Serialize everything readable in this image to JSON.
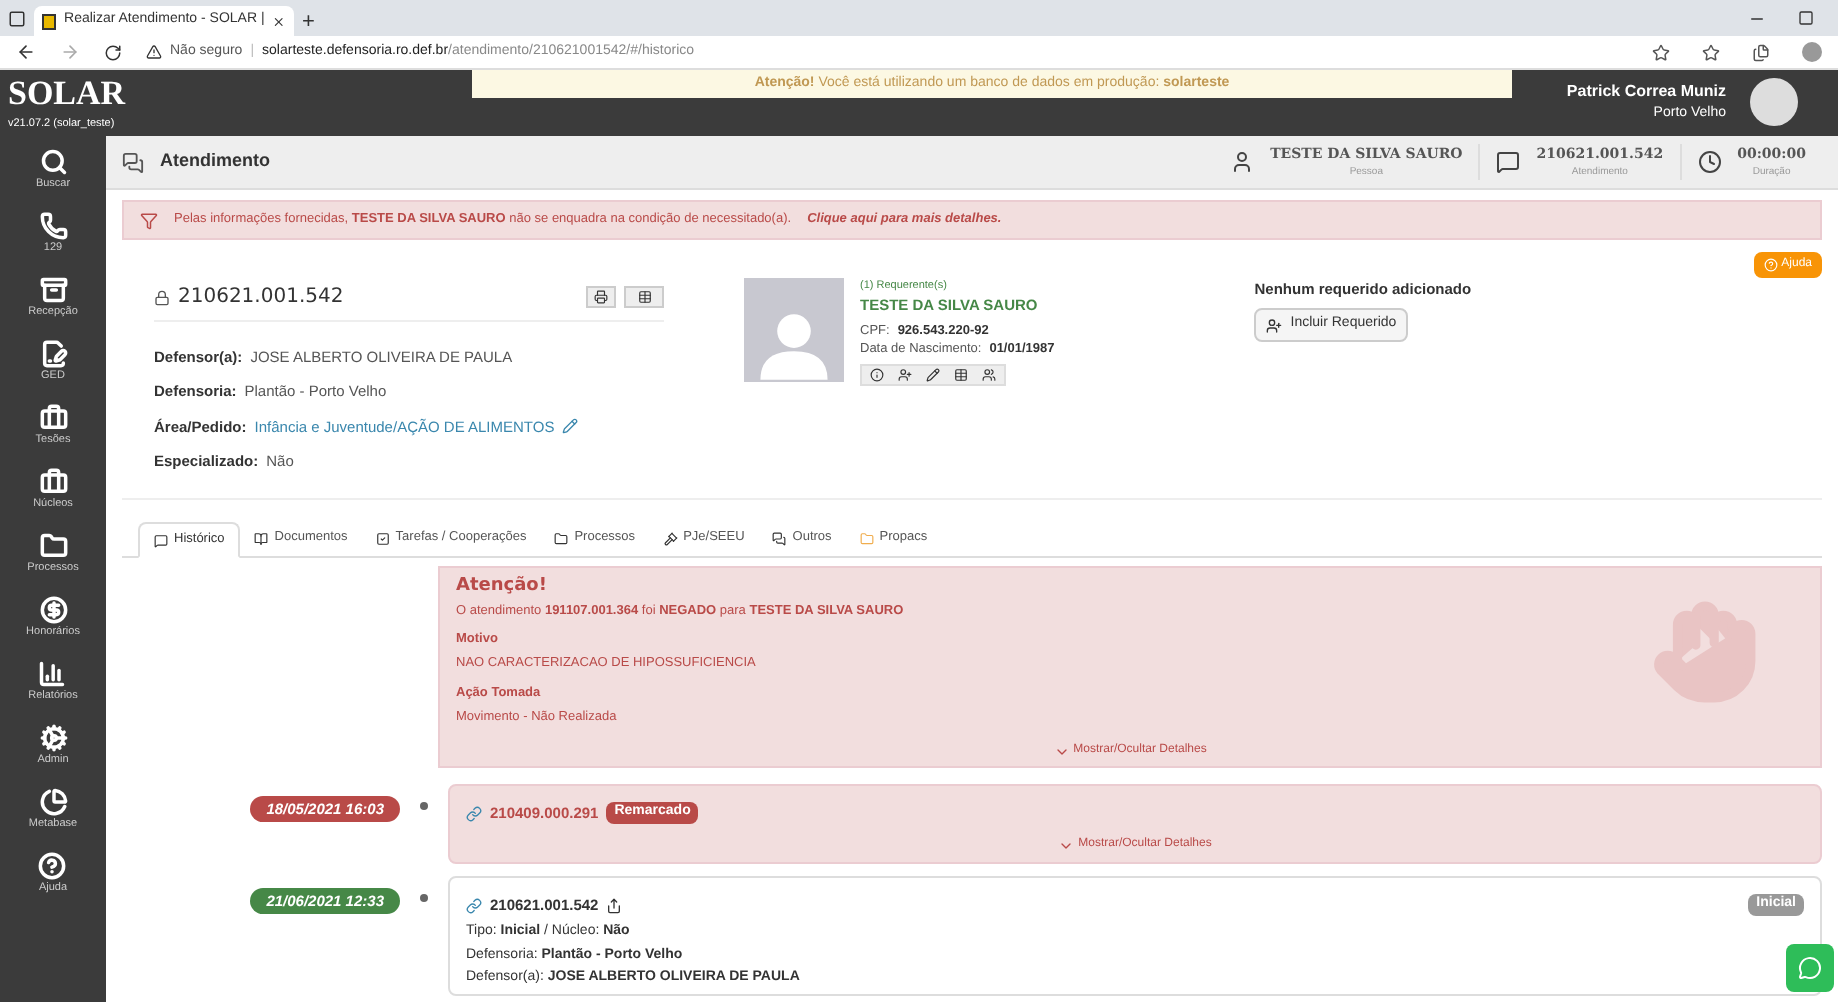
{
  "browser": {
    "tab_title": "Realizar Atendimento - SOLAR |",
    "new_tab": "+",
    "security": "Não seguro",
    "separator": "|",
    "url_host": "solarteste.defensoria.ro.def.br",
    "url_path": "/atendimento/210621001542/#/historico"
  },
  "topbar": {
    "logo": "SOLAR",
    "version": "v21.07.2 (solar_teste)",
    "banner": "**Atenção!** Você está utilizando um banco de dados em produção: **solarteste**",
    "user_name": "Patrick Correa Muniz",
    "user_place": "Porto Velho"
  },
  "sidebar": [
    {
      "label": "Buscar"
    },
    {
      "label": "129"
    },
    {
      "label": "Recepção"
    },
    {
      "label": "GED"
    },
    {
      "label": "Tesões"
    },
    {
      "label": "Núcleos"
    },
    {
      "label": "Processos"
    },
    {
      "label": "Honorários"
    },
    {
      "label": "Relatórios"
    },
    {
      "label": "Admin"
    },
    {
      "label": "Metabase"
    },
    {
      "label": "Ajuda"
    }
  ],
  "header": {
    "title": "Atendimento",
    "stats": [
      {
        "value": "TESTE DA SILVA SAURO",
        "label": "Pessoa"
      },
      {
        "value": "210621.001.542",
        "label": "Atendimento"
      },
      {
        "value": "00:00:00",
        "label": "Duração"
      }
    ]
  },
  "alert": {
    "text": "Pelas informações fornecidas, **TESTE DA SILVA SAURO** não se enquadra na condição de necessitado(a).",
    "link": "Clique aqui para mais detalhes."
  },
  "help_button": "Ajuda",
  "case": {
    "number": "210621.001.542",
    "fields": [
      {
        "label": "Defensor(a):",
        "value": "JOSE ALBERTO OLIVEIRA DE PAULA",
        "kind": "plain"
      },
      {
        "label": "Defensoria:",
        "value": "Plantão - Porto Velho",
        "kind": "plain"
      },
      {
        "label": "Área/Pedido:",
        "value": "Infância e Juventude/AÇÃO DE ALIMENTOS",
        "kind": "link"
      },
      {
        "label": "Especializado:",
        "value": "Não",
        "kind": "plain"
      }
    ]
  },
  "requerente": {
    "count": "(1) Requerente(s)",
    "name": "TESTE DA SILVA SAURO",
    "cpf_label": "CPF:",
    "cpf": "926.543.220-92",
    "birth_label": "Data de Nascimento:",
    "birth": "01/01/1987"
  },
  "requerido": {
    "empty": "Nenhum requerido adicionado",
    "button": "Incluir Requerido"
  },
  "tabs": [
    {
      "label": "Histórico",
      "selected": true
    },
    {
      "label": "Documentos",
      "selected": false
    },
    {
      "label": "Tarefas / Cooperações",
      "selected": false
    },
    {
      "label": "Processos",
      "selected": false
    },
    {
      "label": "PJe/SEEU",
      "selected": false
    },
    {
      "label": "Outros",
      "selected": false
    },
    {
      "label": "Propacs",
      "selected": false
    }
  ],
  "notice": {
    "title": "Atenção!",
    "text": "O atendimento **191107.001.364** foi **NEGADO** para **TESTE DA SILVA SAURO**",
    "sections": [
      {
        "label": "Motivo",
        "value": "NAO CARACTERIZACAO DE HIPOSSUFICIENCIA"
      },
      {
        "label": "Ação Tomada",
        "value": "Movimento - Não Realizada"
      }
    ],
    "toggle": "Mostrar/Ocultar Detalhes"
  },
  "timeline": [
    {
      "kind": "remarcado",
      "date": "18/05/2021 16:03",
      "color": "#b94a48",
      "number": "210409.000.291",
      "badge": "Remarcado",
      "toggle": "Mostrar/Ocultar Detalhes"
    },
    {
      "kind": "inicial",
      "date": "21/06/2021 12:33",
      "color": "#468847",
      "number": "210621.001.542",
      "badge": "Inicial",
      "lines": [
        "Tipo: **Inicial** / Núcleo: **Não**",
        "Defensoria: **Plantão - Porto Velho**",
        "Defensor(a): **JOSE ALBERTO OLIVEIRA DE PAULA**"
      ]
    }
  ]
}
